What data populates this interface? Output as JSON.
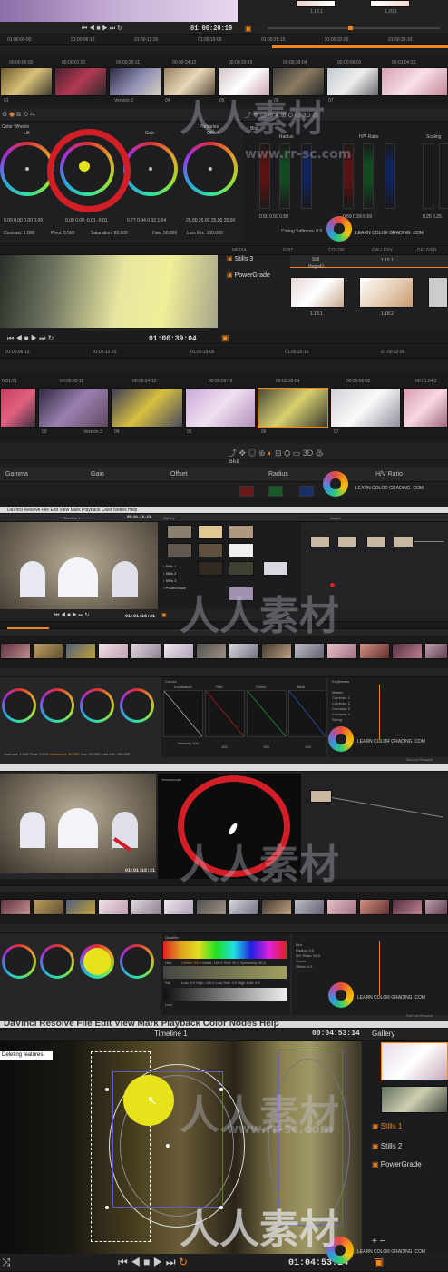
{
  "p1": {
    "still_labels": [
      "1.18.1",
      "1.20.1"
    ],
    "timecode": "01:00:20:19",
    "ruler": [
      "01:00:00:00",
      "01:00:06:10",
      "01:00:12:20",
      "01:00:19:05",
      "01:00:25:15",
      "01:00:32:00",
      "01:00:38:10"
    ],
    "clip_tcs": [
      "00:00:00:00",
      "00:00:01:21",
      "00:00:20:11",
      "00:00:24:12",
      "00:00:29:19",
      "00:00:39:04",
      "00:00:56:02",
      "00:01:04:23"
    ],
    "clip_nums": [
      "01",
      "v1",
      "02",
      "v1",
      "Version 3",
      "04",
      "v1",
      "05",
      "v1",
      "06",
      "v1",
      "07",
      "v1"
    ],
    "wheels_title": "Color Wheels",
    "wheel_labels": [
      "Lift",
      "Gamma",
      "Gain",
      "Offset"
    ],
    "mode_label": "Primaries",
    "wheel_values": [
      [
        "0.00",
        "0.00",
        "0.00",
        "0.00"
      ],
      [
        "0.00",
        "0.00",
        "-0.01",
        "-0.01"
      ],
      [
        "0.77",
        "0.94",
        "0.92",
        "1.04"
      ],
      [
        "25.00",
        "25.00",
        "25.00",
        "25.00"
      ]
    ],
    "bottom_params": [
      "Contrast: 1.000",
      "Pivot: 0.500",
      "Saturation: 92.800",
      "Hue: 50.000",
      "Lum Mix: 100.000"
    ],
    "blur_title": "Blur",
    "blur_cols": [
      "Radius",
      "H/V Ratio",
      "Scaling"
    ],
    "blur_values": [
      "0.50",
      "0.50",
      "0.50",
      "0.59",
      "0.59",
      "0.59",
      "0.25",
      "0.25"
    ],
    "coring": "Coring Softness: 0.0",
    "tabs": [
      "MEDIA",
      "EDIT",
      "COLOR",
      "GALLERY",
      "DELIVER"
    ]
  },
  "p2": {
    "still_header": "Still",
    "still_name": "Hugo41",
    "items": [
      "Stills 3",
      "PowerGrade"
    ],
    "still_ids": [
      "1.15.1",
      "1.18.1",
      "1.18.2"
    ],
    "timecode": "01:00:39:04",
    "ruler": [
      "01:00:06:10",
      "01:00:12:20",
      "01:00:19:05",
      "01:00:25:15",
      "01:00:32:00"
    ],
    "clip_tcs": [
      "0:01:21",
      "00:00:20:11",
      "00:00:24:12",
      "00:00:29:19",
      "00:00:39:04",
      "00:00:56:02",
      "00:01:04:2"
    ],
    "clip_nums": [
      "03",
      "v1",
      "Version 3",
      "04",
      "v1",
      "05",
      "v1",
      "06",
      "v1",
      "07",
      "v1"
    ],
    "wheel_labels": [
      "Gamma",
      "Gain",
      "Offset"
    ],
    "blur_title": "Blur",
    "blur_cols": [
      "Radius",
      "H/V Ratio"
    ]
  },
  "p3": {
    "menu": [
      "DaVinci Resolve",
      "File",
      "Edit",
      "View",
      "Mark",
      "Playback",
      "Color",
      "Nodes",
      "Help"
    ],
    "timeline": "Timeline 1",
    "timecode": "00:01:16:21",
    "gallery": "Gallery",
    "stills": [
      "Stills 1",
      "Stills 2",
      "Stills 3",
      "PowerGrade"
    ],
    "nodes": "Nodes",
    "curves_title": "Curves",
    "curve_labels": [
      "Luminance",
      "Red",
      "Green",
      "Blue"
    ],
    "intensity": [
      "Intensity",
      "100",
      "100",
      "100",
      "100"
    ],
    "bottom_params": [
      "Contrast: 1.000",
      "Pivot: 0.500",
      "Saturation: 50.000",
      "Hue: 50.000",
      "Lum Mix: 100.000"
    ],
    "keyframes": "Keyframes",
    "keyframe_tracks": [
      "Master",
      "Corrector 1",
      "Corrector 2",
      "Corrector 3",
      "Corrector 4",
      "Sizing"
    ],
    "viewer_tc": "01:01:16:21",
    "brand": "DaVinci Resolve"
  },
  "p4": {
    "title": "Vectorscope",
    "viewer_tc": "01:01:16:21",
    "qualifier_title": "Qualifier",
    "hsl_labels": [
      "Hue",
      "Sat",
      "Lum"
    ],
    "center_vals": [
      "Center: 50.0",
      "Width: 100.0",
      "Soft: 30.0",
      "Symmetry: 50.0"
    ],
    "low_high": [
      "Low: 0.0",
      "High: 100.0",
      "Low Soft: 0.0",
      "High Soft: 0.0"
    ],
    "blur_labels": [
      "Blur",
      "Radius: 0.0",
      "H/V Ratio: 50.0",
      "Shrink",
      "Offset: 0.0"
    ],
    "brand": "DaVinci Resolve"
  },
  "p5": {
    "menu": [
      "DaVinci Resolve",
      "File",
      "Edit",
      "View",
      "Mark",
      "Playback",
      "Color",
      "Nodes",
      "Help"
    ],
    "timeline": "Timeline 1",
    "timecode": "00:04:53:14",
    "gallery": "Gallery",
    "tooltip": "Deleting features.",
    "stills": [
      "Stills 1",
      "Stills 2",
      "PowerGrade"
    ],
    "bottom_tc": "01:04:53:14"
  },
  "watermark": {
    "cn": "人人素材",
    "url": "www.rr-sc.com",
    "brand": "LEARN COLOR GRADING .COM"
  },
  "colors": {
    "accent": "#f0861e",
    "red_circle": "#d21e26",
    "bg": "#1f1f21"
  }
}
